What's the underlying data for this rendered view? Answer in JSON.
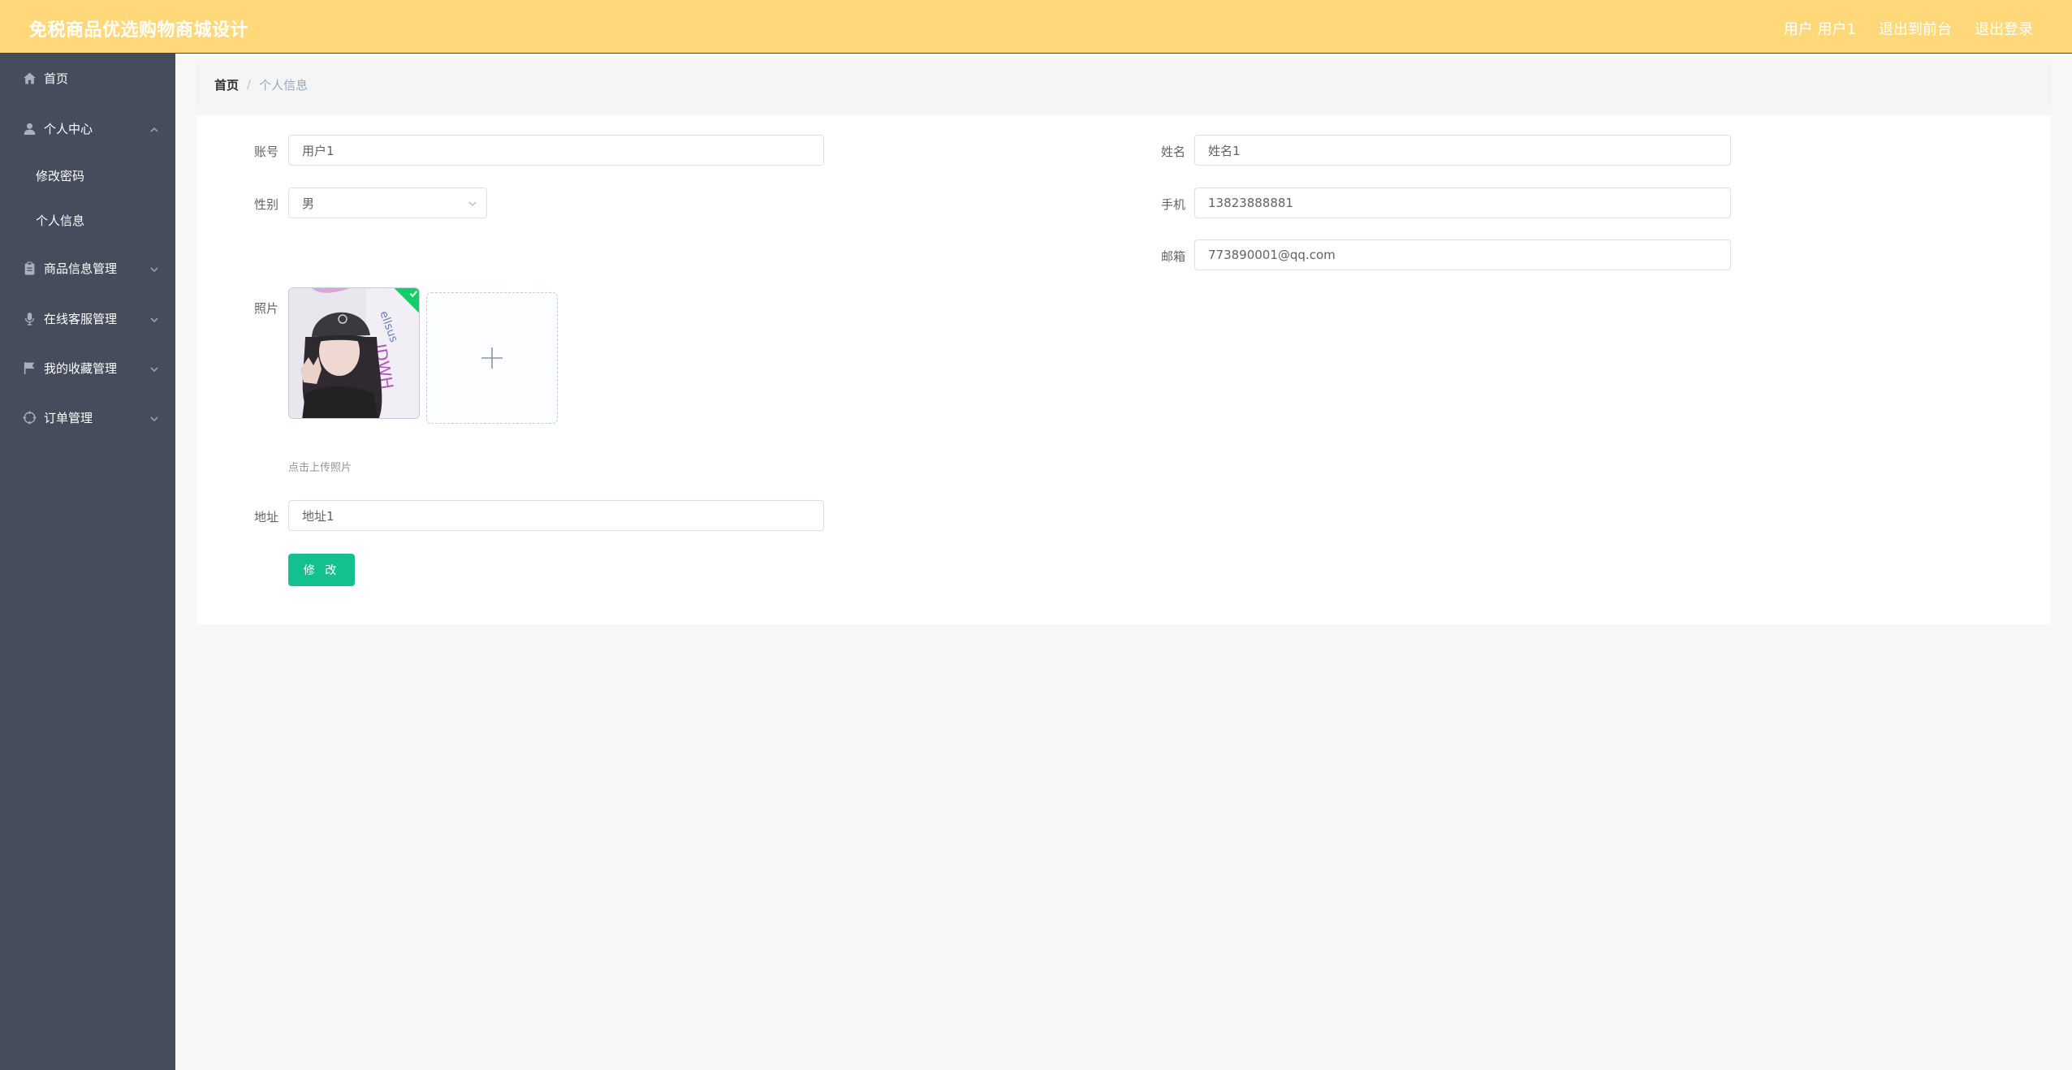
{
  "header": {
    "title": "免税商品优选购物商城设计",
    "links": [
      "用户 用户1",
      "退出到前台",
      "退出登录"
    ]
  },
  "sidebar": {
    "items": [
      {
        "label": "首页",
        "icon": "home-icon"
      },
      {
        "label": "个人中心",
        "icon": "user-icon",
        "expanded": true,
        "children": [
          "修改密码",
          "个人信息"
        ]
      },
      {
        "label": "商品信息管理",
        "icon": "clipboard-icon"
      },
      {
        "label": "在线客服管理",
        "icon": "microphone-icon"
      },
      {
        "label": "我的收藏管理",
        "icon": "flag-icon"
      },
      {
        "label": "订单管理",
        "icon": "crosshair-icon"
      }
    ]
  },
  "breadcrumb": {
    "home": "首页",
    "separator": "/",
    "current": "个人信息"
  },
  "form": {
    "account": {
      "label": "账号",
      "value": "用户1"
    },
    "name": {
      "label": "姓名",
      "value": "姓名1"
    },
    "gender": {
      "label": "性别",
      "value": "男"
    },
    "phone": {
      "label": "手机",
      "value": "13823888881"
    },
    "email": {
      "label": "邮箱",
      "value": "773890001@qq.com"
    },
    "photo": {
      "label": "照片",
      "hint": "点击上传照片"
    },
    "address": {
      "label": "地址",
      "value": "地址1"
    },
    "submit_label": "修 改"
  },
  "colors": {
    "header_bg": "#ffd87a",
    "sidebar_bg": "#454c5c",
    "primary_button": "#13c08f",
    "success_badge": "#13ce66"
  }
}
